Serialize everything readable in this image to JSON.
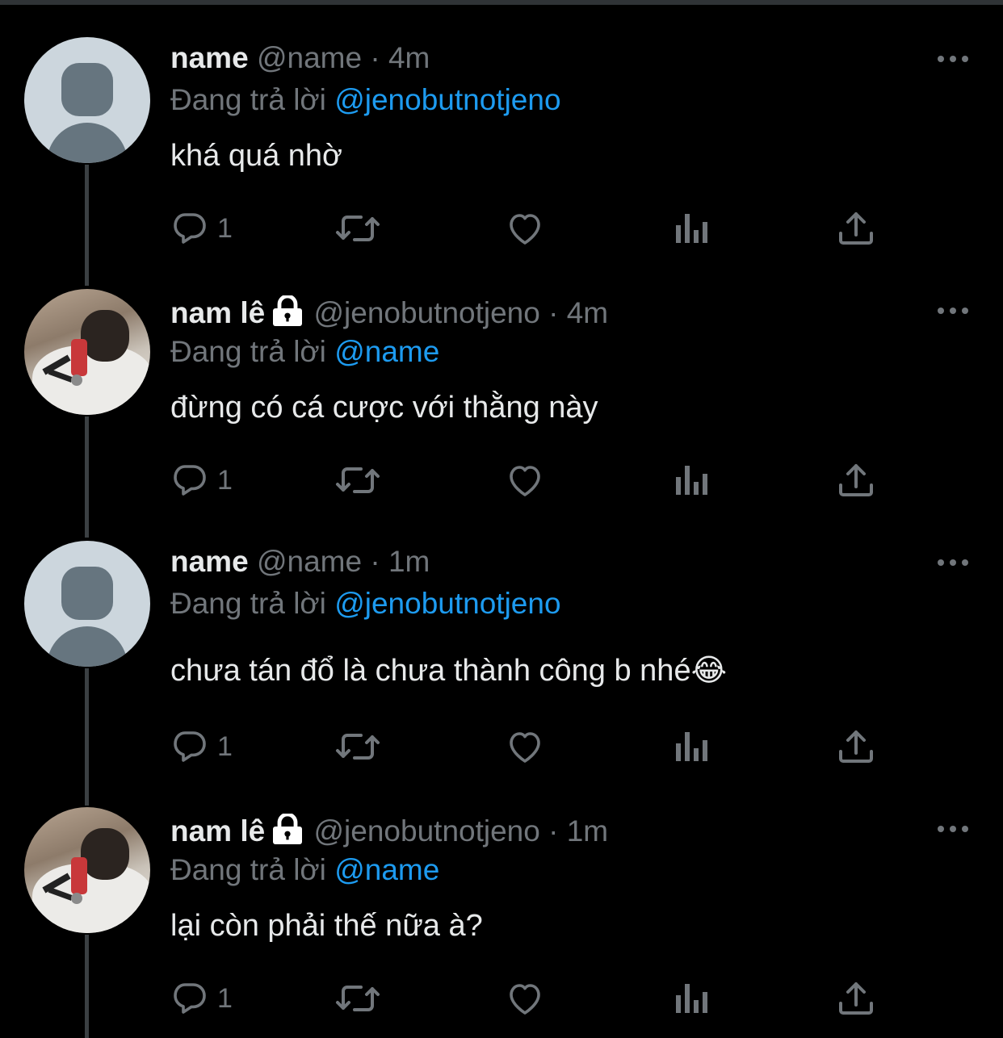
{
  "replying_prefix": "Đang trả lời",
  "tweets": [
    {
      "display_name": "name",
      "handle": "@name",
      "separator": "·",
      "time": "4m",
      "replying_to": "@jenobutnotjeno",
      "text": "khá quá nhờ",
      "reply_count": "1",
      "avatar": "default-avatar",
      "protected": false
    },
    {
      "display_name": "nam lê",
      "handle": "@jenobutnotjeno",
      "separator": "·",
      "time": "4m",
      "replying_to": "@name",
      "text": "đừng có cá cược với thằng này",
      "reply_count": "1",
      "avatar": "photo-avatar",
      "protected": true
    },
    {
      "display_name": "name",
      "handle": "@name",
      "separator": "·",
      "time": "1m",
      "replying_to": "@jenobutnotjeno",
      "text": "chưa tán đổ là chưa thành công b nhé😂",
      "reply_count": "1",
      "avatar": "default-avatar",
      "protected": false
    },
    {
      "display_name": "nam lê",
      "handle": "@jenobutnotjeno",
      "separator": "·",
      "time": "1m",
      "replying_to": "@name",
      "text": "lại còn phải thế nữa à?",
      "reply_count": "1",
      "avatar": "photo-avatar",
      "protected": true
    }
  ],
  "icons": [
    "reply-icon",
    "retweet-icon",
    "like-icon",
    "analytics-icon",
    "share-icon",
    "more-icon",
    "lock-icon"
  ],
  "colors": {
    "background": "#000000",
    "text": "#e7e9ea",
    "secondary": "#71767b",
    "link": "#1d9bf0",
    "thread_line": "#3b4043"
  }
}
